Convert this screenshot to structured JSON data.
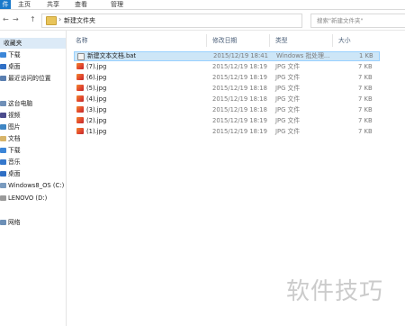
{
  "ribbon": {
    "tabs": [
      {
        "label": "件"
      },
      {
        "label": "主页"
      },
      {
        "label": "共享"
      },
      {
        "label": "查看"
      },
      {
        "label": "管理"
      }
    ]
  },
  "address": {
    "back": "←",
    "forward": "→",
    "up": "↑",
    "path": "新建文件夹",
    "search_placeholder": "搜索\"新建文件夹\""
  },
  "nav": {
    "items": [
      {
        "label": "收藏夹",
        "kind": "head",
        "icon": "star-icon"
      },
      {
        "label": "下载",
        "icon": "download-icon",
        "color": "#3c86d8"
      },
      {
        "label": "桌面",
        "icon": "desktop-icon",
        "color": "#2f6fc5"
      },
      {
        "label": "最近访问的位置",
        "icon": "recent-icon",
        "color": "#5a7fb0"
      },
      {
        "label": "这台电脑",
        "kind": "head",
        "icon": "computer-icon"
      },
      {
        "label": "视频",
        "icon": "video-icon",
        "color": "#4b4b8c"
      },
      {
        "label": "图片",
        "icon": "pictures-icon",
        "color": "#3f86c4"
      },
      {
        "label": "文档",
        "icon": "documents-icon",
        "color": "#d7b46a"
      },
      {
        "label": "下载",
        "icon": "download-icon",
        "color": "#3c86d8"
      },
      {
        "label": "音乐",
        "icon": "music-icon",
        "color": "#3578cc"
      },
      {
        "label": "桌面",
        "icon": "desktop-icon",
        "color": "#2f6fc5"
      },
      {
        "label": "Windows8_OS (C:)",
        "icon": "drive-icon",
        "color": "#7a9bbf"
      },
      {
        "label": "LENOVO (D:)",
        "icon": "drive-icon",
        "color": "#9a9a9a"
      },
      {
        "label": "网络",
        "kind": "head",
        "icon": "network-icon"
      }
    ]
  },
  "columns": {
    "name": "名称",
    "date": "修改日期",
    "type": "类型",
    "size": "大小"
  },
  "files": [
    {
      "name": "新建文本文档.bat",
      "date": "2015/12/19 18:41",
      "type": "Windows 批处理...",
      "size": "1 KB",
      "icon": "bat-file-icon",
      "selected": true
    },
    {
      "name": "(7).jpg",
      "date": "2015/12/19 18:19",
      "type": "JPG 文件",
      "size": "7 KB",
      "icon": "jpg-file-icon"
    },
    {
      "name": "(6).jpg",
      "date": "2015/12/19 18:19",
      "type": "JPG 文件",
      "size": "7 KB",
      "icon": "jpg-file-icon"
    },
    {
      "name": "(5).jpg",
      "date": "2015/12/19 18:18",
      "type": "JPG 文件",
      "size": "7 KB",
      "icon": "jpg-file-icon"
    },
    {
      "name": "(4).jpg",
      "date": "2015/12/19 18:18",
      "type": "JPG 文件",
      "size": "7 KB",
      "icon": "jpg-file-icon"
    },
    {
      "name": "(3).jpg",
      "date": "2015/12/19 18:18",
      "type": "JPG 文件",
      "size": "7 KB",
      "icon": "jpg-file-icon"
    },
    {
      "name": "(2).jpg",
      "date": "2015/12/19 18:19",
      "type": "JPG 文件",
      "size": "7 KB",
      "icon": "jpg-file-icon"
    },
    {
      "name": "(1).jpg",
      "date": "2015/12/19 18:19",
      "type": "JPG 文件",
      "size": "7 KB",
      "icon": "jpg-file-icon"
    }
  ],
  "watermark": "软件技巧"
}
